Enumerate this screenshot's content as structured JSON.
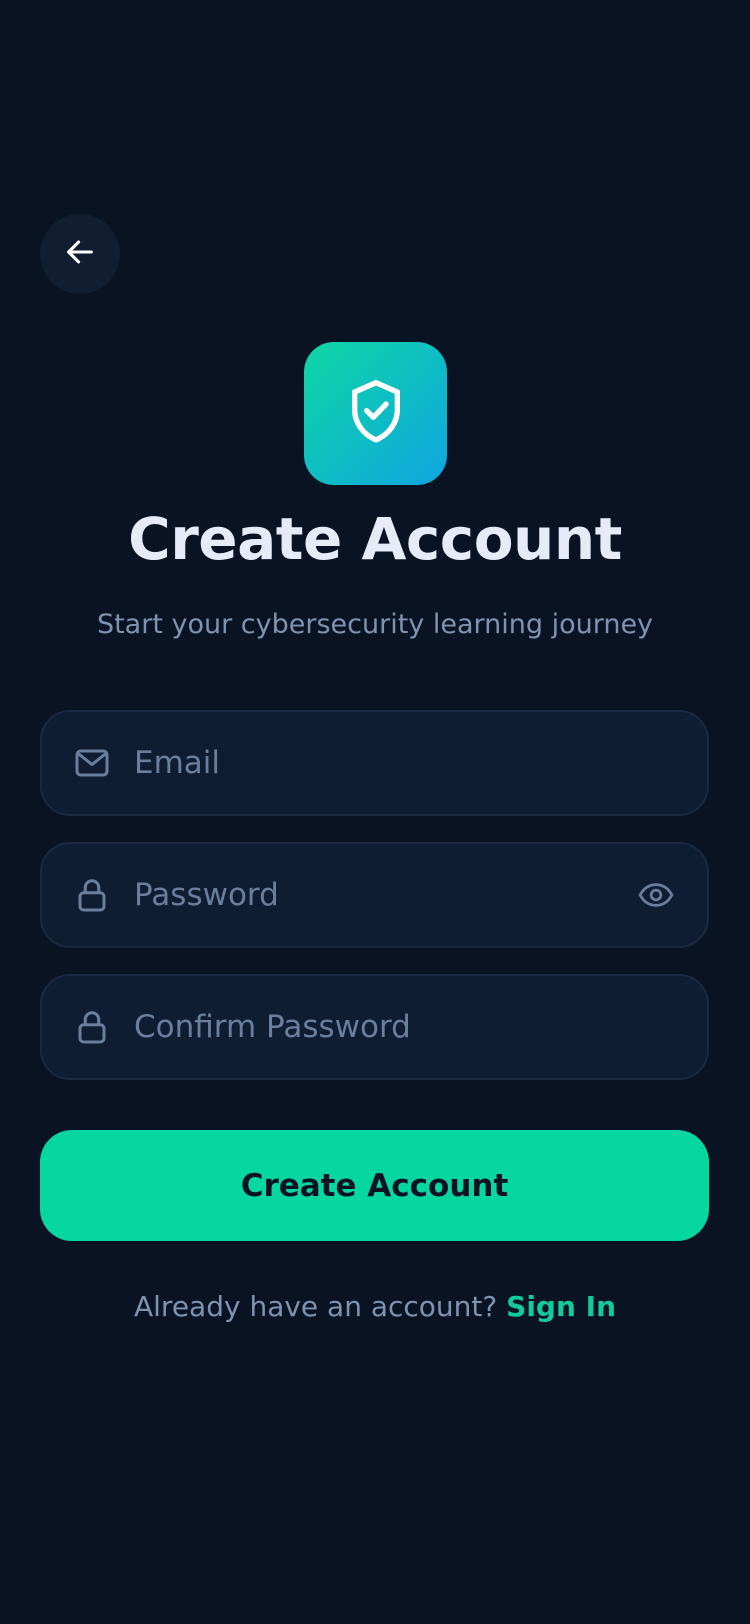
{
  "header": {
    "back_icon": "arrow-left-icon"
  },
  "logo": {
    "icon": "shield-check-icon",
    "gradient_start": "#0fd6a4",
    "gradient_end": "#0ea6e0"
  },
  "title": "Create Account",
  "subtitle": "Start your cybersecurity learning journey",
  "form": {
    "email": {
      "placeholder": "Email",
      "value": "",
      "icon": "mail-icon"
    },
    "password": {
      "placeholder": "Password",
      "value": "",
      "icon": "lock-icon",
      "toggle_icon": "eye-icon"
    },
    "confirm_password": {
      "placeholder": "Confirm Password",
      "value": "",
      "icon": "lock-icon"
    }
  },
  "submit_label": "Create Account",
  "footer": {
    "prompt": "Already have an account?",
    "link": "Sign In"
  },
  "colors": {
    "background": "#0a1324",
    "accent": "#06d6a0",
    "field_bg": "#0f1d33",
    "muted_text": "#7f93ae"
  }
}
